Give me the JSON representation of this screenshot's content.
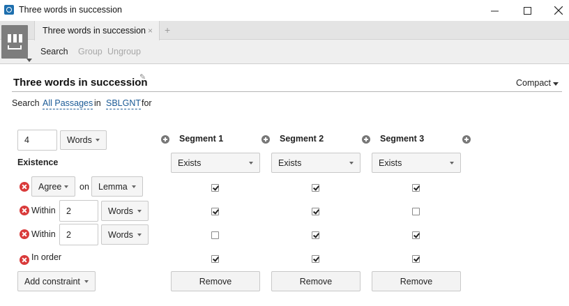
{
  "window": {
    "title": "Three words in succession",
    "app_icon": "logos-icon",
    "controls": [
      "minimize-icon",
      "maximize-icon",
      "close-icon"
    ]
  },
  "tabs": {
    "active_label": "Three words in succession",
    "close_glyph": "×",
    "add_glyph": "+"
  },
  "toolbar": {
    "search": "Search",
    "group": "Group",
    "ungroup": "Ungroup"
  },
  "document": {
    "title": "Three words in succession",
    "edit_glyph": "✎",
    "view_mode": "Compact"
  },
  "search_line": {
    "prefix": "Search",
    "range": "All Passages",
    "in_word": "in",
    "resource": "SBLGNT",
    "for_word": "for"
  },
  "span": {
    "count": "4",
    "unit": "Words"
  },
  "existence_label": "Existence",
  "segments": [
    {
      "name": "Segment 1",
      "existence": "Exists",
      "remove": "Remove"
    },
    {
      "name": "Segment 2",
      "existence": "Exists",
      "remove": "Remove"
    },
    {
      "name": "Segment 3",
      "existence": "Exists",
      "remove": "Remove"
    }
  ],
  "constraints": {
    "agree": {
      "type": "Agree",
      "on_word": "on",
      "attribute": "Lemma",
      "checks": [
        true,
        true,
        true
      ]
    },
    "within_1": {
      "label": "Within",
      "value": "2",
      "unit": "Words",
      "checks": [
        true,
        true,
        false
      ]
    },
    "within_2": {
      "label": "Within",
      "value": "2",
      "unit": "Words",
      "checks": [
        false,
        true,
        true
      ]
    },
    "in_order": {
      "label": "In order",
      "checks": [
        true,
        true,
        true
      ]
    }
  },
  "add_constraint": "Add constraint",
  "colors": {
    "link": "#1a5a96",
    "remove_icon": "#d93a3a",
    "app_icon": "#1e6fae"
  }
}
